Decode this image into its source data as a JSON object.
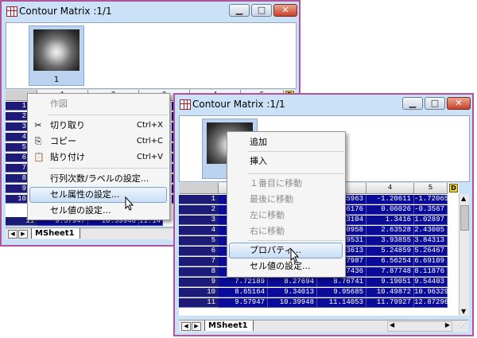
{
  "back": {
    "title": "Contour Matrix :1/1",
    "thumb_label": "1",
    "col_headers": [
      "1",
      "2",
      "3",
      "4",
      "5"
    ],
    "row_numbers": [
      "1",
      "2",
      "3",
      "4",
      "5",
      "6",
      "7",
      "8",
      "9",
      "10",
      "11"
    ],
    "right_col_digits": [
      "5",
      "6",
      "6",
      "6",
      "8",
      "6",
      "3",
      "6",
      "8",
      "9",
      "9"
    ],
    "last_row_cells": [
      "9.57947",
      "10.39948",
      "11.14"
    ],
    "sheet_tab": "MSheet1",
    "d_button": "D"
  },
  "back_menu": {
    "items": [
      {
        "label": "作図",
        "shortcut": "",
        "disabled": true,
        "icon": ""
      },
      {
        "label": "切り取り",
        "shortcut": "Ctrl+X",
        "disabled": false,
        "icon": "cut-icon"
      },
      {
        "label": "コピー",
        "shortcut": "Ctrl+C",
        "disabled": false,
        "icon": "copy-icon"
      },
      {
        "label": "貼り付け",
        "shortcut": "Ctrl+V",
        "disabled": false,
        "icon": "paste-icon"
      },
      {
        "label": "行列次数/ラベルの設定...",
        "shortcut": "",
        "disabled": false,
        "icon": ""
      },
      {
        "label": "セル属性の設定...",
        "shortcut": "",
        "disabled": false,
        "icon": "",
        "highlighted": true
      },
      {
        "label": "セル値の設定...",
        "shortcut": "",
        "disabled": false,
        "icon": ""
      }
    ]
  },
  "front": {
    "title": "Contour Matrix :1/1",
    "col_headers": [
      "4",
      "5"
    ],
    "d_button": "D",
    "row_numbers": [
      "1",
      "2",
      "3",
      "4",
      "5",
      "6",
      "7",
      "8",
      "9",
      "10",
      "11"
    ],
    "col3_partial": [
      "5963",
      "6176",
      "3104",
      "0958",
      "9531",
      "3613",
      "7987"
    ],
    "rows": [
      [
        "",
        "",
        "",
        "-1.20611",
        "-1.72065"
      ],
      [
        "",
        "",
        "",
        "0.06026",
        "-0.3567"
      ],
      [
        "",
        "",
        "",
        "1.3416",
        "1.02897"
      ],
      [
        "",
        "",
        "",
        "2.63528",
        "2.43005"
      ],
      [
        "",
        "",
        "",
        "3.93855",
        "3.84313"
      ],
      [
        "",
        "",
        "",
        "5.24859",
        "5.26467"
      ],
      [
        "",
        "",
        "",
        "6.56254",
        "6.69109"
      ],
      [
        "6.79094",
        "7.21135",
        "7.57436",
        "7.87748",
        "8.11876"
      ],
      [
        "7.72189",
        "8.27694",
        "8.76741",
        "9.19051",
        "9.54403"
      ],
      [
        "8.65164",
        "9.34013",
        "9.95685",
        "10.49872",
        "10.96329"
      ],
      [
        "9.57947",
        "10.39948",
        "11.14053",
        "11.79927",
        "12.87296"
      ]
    ],
    "sheet_tab": "MSheet1"
  },
  "front_menu": {
    "items": [
      {
        "label": "追加",
        "disabled": false
      },
      {
        "label": "挿入",
        "disabled": false
      },
      {
        "label": "１番目に移動",
        "disabled": true
      },
      {
        "label": "最後に移動",
        "disabled": true
      },
      {
        "label": "左に移動",
        "disabled": true
      },
      {
        "label": "右に移動",
        "disabled": true
      },
      {
        "label": "プロパティ...",
        "disabled": false,
        "highlighted": true
      },
      {
        "label": "セル値の設定...",
        "disabled": false
      }
    ]
  },
  "colors": {
    "window_border": "#b0549c",
    "window_bg": "#cbe1f7",
    "cell_bg": "#0b0b9a",
    "close_button": "#c7412b"
  }
}
